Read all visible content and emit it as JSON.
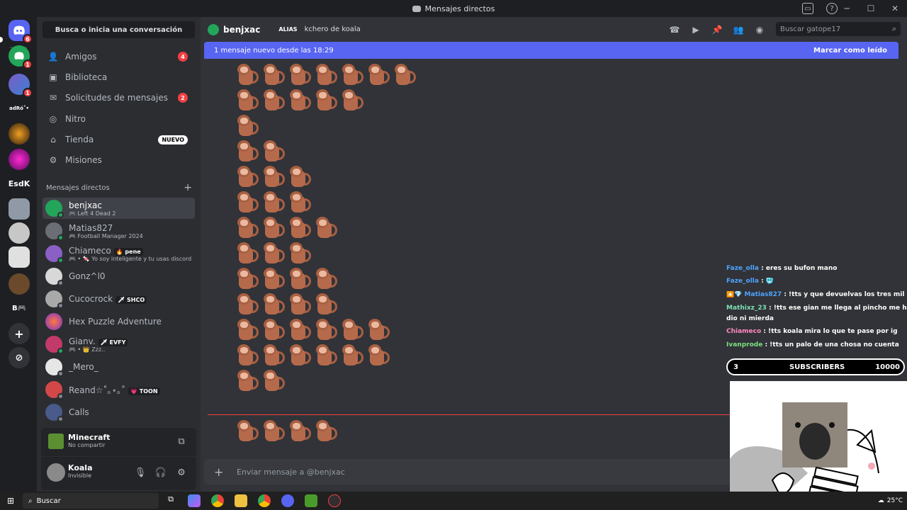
{
  "window": {
    "title": "Mensajes directos"
  },
  "servers": [
    {
      "name": "discord-home",
      "badge": "6"
    },
    {
      "name": "server-1",
      "badge": "1"
    },
    {
      "name": "server-2",
      "badge": "1"
    },
    {
      "name": "server-3",
      "label": "adRó˚•"
    },
    {
      "name": "server-4"
    },
    {
      "name": "server-5"
    },
    {
      "name": "server-6",
      "label": "EsdK"
    },
    {
      "name": "server-7"
    },
    {
      "name": "server-8"
    },
    {
      "name": "server-9"
    },
    {
      "name": "server-10"
    },
    {
      "name": "server-11",
      "label": "B🎮"
    }
  ],
  "sidebar": {
    "search_label": "Busca o inicia una conversación",
    "nav": [
      {
        "label": "Amigos",
        "count": "4"
      },
      {
        "label": "Biblioteca"
      },
      {
        "label": "Solicitudes de mensajes",
        "count": "2"
      },
      {
        "label": "Nitro"
      },
      {
        "label": "Tienda",
        "tag": "NUEVO"
      },
      {
        "label": "Misiones"
      }
    ],
    "dm_header": "Mensajes directos",
    "dms": [
      {
        "name": "benjxac",
        "sub": "🎮 Left 4 Dead 2"
      },
      {
        "name": "Matias827",
        "sub": "🎮 Football Manager 2024"
      },
      {
        "name": "Chiameco",
        "tag": "🔥 pene",
        "sub": "🎮 • 🍬 Yo soy inteligente y tu usas discord"
      },
      {
        "name": "Gonz^l0"
      },
      {
        "name": "Cucocrock",
        "tag": "🗡 SHCO"
      },
      {
        "name": "Hex Puzzle Adventure"
      },
      {
        "name": "Gianv.",
        "tag": "🗡 EVFY",
        "sub": "🎮 • 👑 Zzz.."
      },
      {
        "name": "_Mero_"
      },
      {
        "name": "Reand☆˚｡⋆｡˚",
        "tag": "💗 TOON"
      },
      {
        "name": "Calls"
      }
    ],
    "activity": {
      "title": "Minecraft",
      "sub": "No compartir"
    },
    "user": {
      "name": "Koala",
      "status": "Invisible"
    }
  },
  "header": {
    "name": "benjxac",
    "alias_label": "ALIAS",
    "alias_value": "kchero de koala",
    "search_placeholder": "Buscar gatope17"
  },
  "banner": {
    "text": "1 mensaje nuevo desde las 18:29",
    "action": "Marcar como leído"
  },
  "messages": {
    "monkey_counts": [
      7,
      5,
      1,
      2,
      3,
      3,
      4,
      3,
      4,
      4,
      6,
      6,
      2
    ],
    "after_separator": [
      4
    ]
  },
  "composer": {
    "placeholder": "Enviar mensaje a @benjxac"
  },
  "stream_chat": [
    {
      "user": "Faze_olla",
      "color": "#4fa3ff",
      "text": ": eres su bufon mano"
    },
    {
      "user": "Faze_olla",
      "color": "#4fa3ff",
      "text": ": 🥶"
    },
    {
      "user": "🔼💎 Matias827",
      "color": "#4fa3ff",
      "text": ": !tts y que devuelvas los tres mil minecoins"
    },
    {
      "user": "Mathixz_23",
      "color": "#7ee0b4",
      "text": ": !tts ese gian me llega al pincho me hizo de"
    },
    {
      "user": "",
      "color": "#ffffff",
      "text": "dio ni mierda"
    },
    {
      "user": "Chiameco",
      "color": "#ff8ac0",
      "text": ": !tts koala mira lo que te pase por ig"
    },
    {
      "user": "Ivanprode",
      "color": "#7ee07e",
      "text": ": !tts un palo de una chosa no cuenta"
    }
  ],
  "subscribers": {
    "count": "3",
    "label": "SUBSCRIBERS",
    "goal": "10000"
  },
  "taskbar": {
    "search": "Buscar",
    "temp": "25°C"
  }
}
